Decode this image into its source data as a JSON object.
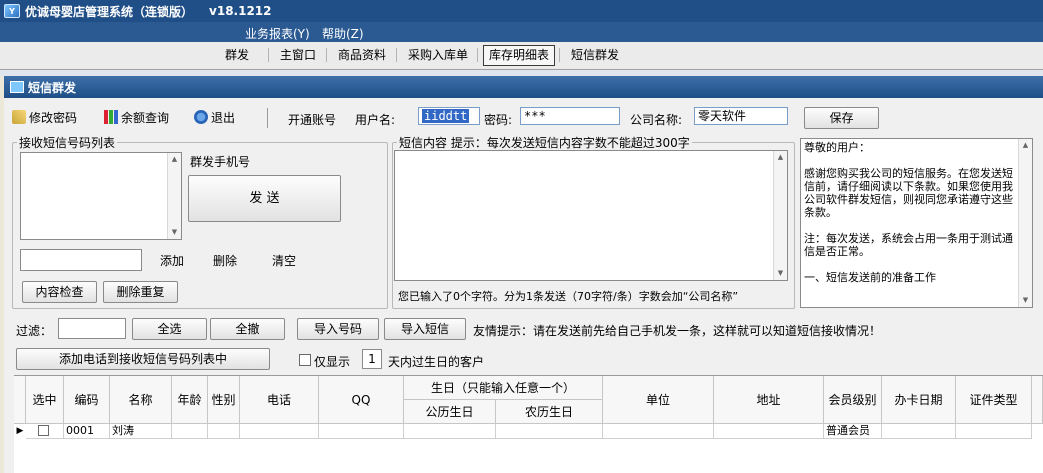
{
  "app": {
    "title": "优诚母婴店管理系统（连锁版）",
    "version": "v18.1212"
  },
  "menu": [
    {
      "label": "业务报表(Y)"
    },
    {
      "label": "帮助(Z)"
    }
  ],
  "tabs": [
    {
      "label": "群发"
    },
    {
      "label": "主窗口"
    },
    {
      "label": "商品资料"
    },
    {
      "label": "采购入库单"
    },
    {
      "label": "库存明细表",
      "active": true
    },
    {
      "label": "短信群发"
    }
  ],
  "window": {
    "title": "短信群发"
  },
  "toolbar": {
    "change_password": "修改密码",
    "balance_query": "余额查询",
    "exit": "退出",
    "open_account": "开通账号",
    "username_label": "用户名:",
    "username_value": "iiddtt",
    "password_label": "密码:",
    "password_value": "***",
    "company_label": "公司名称:",
    "company_value": "零天软件",
    "save": "保存"
  },
  "recipients": {
    "legend": "接收短信号码列表",
    "mass_phone_label": "群发手机号",
    "send": "发  送",
    "add": "添加",
    "delete": "删除",
    "clear": "清空",
    "check_content": "内容检查",
    "remove_duplicates": "删除重复"
  },
  "sms": {
    "legend": "短信内容  提示：每次发送短信内容字数不能超过300字",
    "status": "您已输入了0个字符。分为1条发送（70字符/条）字数会加“公司名称”"
  },
  "notice": {
    "lines": [
      "尊敬的用户：",
      "",
      "    感谢您购买我公司的短信服务。在您发送短信前，请仔细阅读以下条款。如果您使用我公司软件群发短信，则视同您承诺遵守这些条款。",
      "",
      "    注：每次发送，系统会占用一条用于测试通信是否正常。",
      "",
      "一、短信发送前的准备工作"
    ]
  },
  "filter": {
    "label": "过滤：",
    "select_all": "全选",
    "deselect_all": "全撤",
    "import_numbers": "导入号码",
    "import_sms": "导入短信",
    "tip": "友情提示：请在发送前先给自己手机发一条，这样就可以知道短信接收情况！",
    "add_to_list": "添加电话到接收短信号码列表中",
    "only_show": "仅显示",
    "days_value": "1",
    "days_suffix": "天内过生日的客户"
  },
  "grid": {
    "headers": {
      "selected": "选中",
      "code": "编码",
      "name": "名称",
      "age": "年龄",
      "gender": "性别",
      "phone": "电话",
      "qq": "QQ",
      "birthday": "生日（只能输入任意一个）",
      "solar_birthday": "公历生日",
      "lunar_birthday": "农历生日",
      "unit": "单位",
      "address": "地址",
      "member_level": "会员级别",
      "card_date": "办卡日期",
      "id_type": "证件类型"
    },
    "rows": [
      {
        "code": "0001",
        "name": "刘涛",
        "member_level": "普通会员"
      }
    ]
  }
}
